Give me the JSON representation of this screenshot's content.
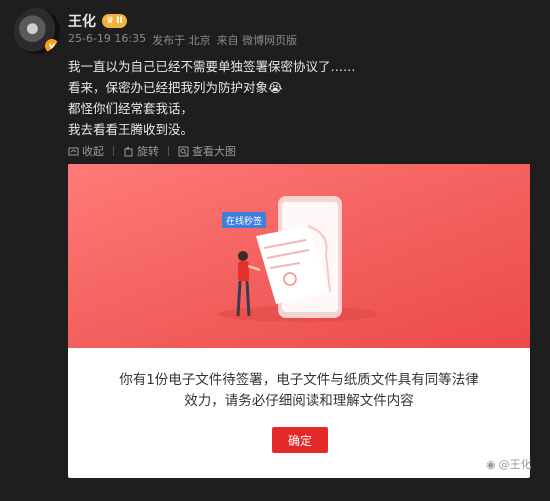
{
  "user": {
    "name": "王化",
    "level_badge": "II",
    "verified_mark": "v"
  },
  "meta": {
    "time": "25-6-19 16:35",
    "location": "发布于 北京",
    "source": "来自 微博网页版"
  },
  "post": {
    "lines": [
      "我一直以为自己已经不需要单独签署保密协议了……",
      "看来，保密办已经把我列为防护对象😭",
      "都怪你们经常套我话，",
      "我去看看王腾收到没。"
    ]
  },
  "actions": {
    "collect": "收起",
    "rotate": "旋转",
    "view_large": "查看大图"
  },
  "card": {
    "tag_label": "在线秒签",
    "message_lines": [
      "你有1份电子文件待签署，电子文件与纸质文件具有同等法律",
      "效力，请务必仔细阅读和理解文件内容"
    ],
    "confirm_label": "确定"
  },
  "watermark": "@王化",
  "colors": {
    "accent_red": "#e42a28",
    "badge_gold": "#f3b23a",
    "hero_gradient_start": "#ff7a78",
    "hero_gradient_end": "#ec4a48"
  }
}
